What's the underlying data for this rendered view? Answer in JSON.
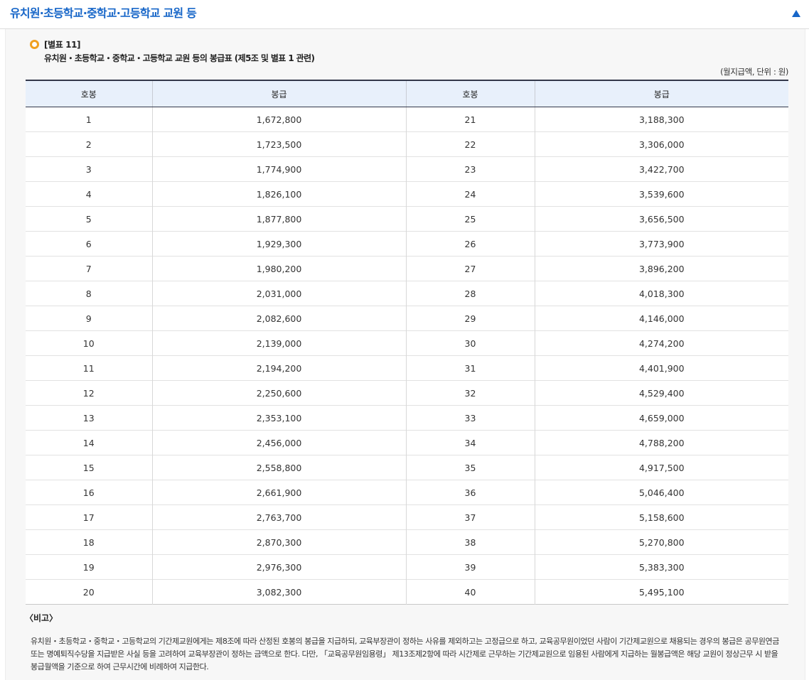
{
  "section": {
    "title": "유치원·초등학교·중학교·고등학교 교원 등"
  },
  "caption": {
    "table_ref": "[별표 11]",
    "title": "유치원・초등학교・중학교・고등학교 교원 등의 봉급표 (제5조 및 별표 1 관련)"
  },
  "unit_note": "(월지급액, 단위 : 원)",
  "table": {
    "headers": [
      "호봉",
      "봉급",
      "호봉",
      "봉급"
    ],
    "rows": [
      [
        "1",
        "1,672,800",
        "21",
        "3,188,300"
      ],
      [
        "2",
        "1,723,500",
        "22",
        "3,306,000"
      ],
      [
        "3",
        "1,774,900",
        "23",
        "3,422,700"
      ],
      [
        "4",
        "1,826,100",
        "24",
        "3,539,600"
      ],
      [
        "5",
        "1,877,800",
        "25",
        "3,656,500"
      ],
      [
        "6",
        "1,929,300",
        "26",
        "3,773,900"
      ],
      [
        "7",
        "1,980,200",
        "27",
        "3,896,200"
      ],
      [
        "8",
        "2,031,000",
        "28",
        "4,018,300"
      ],
      [
        "9",
        "2,082,600",
        "29",
        "4,146,000"
      ],
      [
        "10",
        "2,139,000",
        "30",
        "4,274,200"
      ],
      [
        "11",
        "2,194,200",
        "31",
        "4,401,900"
      ],
      [
        "12",
        "2,250,600",
        "32",
        "4,529,400"
      ],
      [
        "13",
        "2,353,100",
        "33",
        "4,659,000"
      ],
      [
        "14",
        "2,456,000",
        "34",
        "4,788,200"
      ],
      [
        "15",
        "2,558,800",
        "35",
        "4,917,500"
      ],
      [
        "16",
        "2,661,900",
        "36",
        "5,046,400"
      ],
      [
        "17",
        "2,763,700",
        "37",
        "5,158,600"
      ],
      [
        "18",
        "2,870,300",
        "38",
        "5,270,800"
      ],
      [
        "19",
        "2,976,300",
        "39",
        "5,383,300"
      ],
      [
        "20",
        "3,082,300",
        "40",
        "5,495,100"
      ]
    ]
  },
  "remarks": {
    "title": "〈비고〉",
    "text": "유치원・초등학교・중학교・고등학교의 기간제교원에게는 제8조에 따라 산정된 호봉의 봉급을 지급하되, 교육부장관이 정하는 사유를 제외하고는 고정급으로 하고, 교육공무원이었던 사람이 기간제교원으로 채용되는 경우의 봉급은 공무원연금 또는 명예퇴직수당을 지급받은 사실 등을 고려하여 교육부장관이 정하는 금액으로 한다. 다만, 「교육공무원임용령」 제13조제2항에 따라 시간제로 근무하는 기간제교원으로 임용된 사람에게 지급하는 월봉급액은 해당 교원이 정상근무 시 받을 봉급월액을 기준으로 하여 근무시간에 비례하여 지급한다."
  },
  "colors": {
    "accent": "#1766c8",
    "bullet": "#f0a020",
    "header_bg": "#e8f0fb",
    "content_bg": "#f7f7f7"
  },
  "icons": {
    "collapse": "triangle-up-icon",
    "bullet": "ring-bullet-icon"
  }
}
